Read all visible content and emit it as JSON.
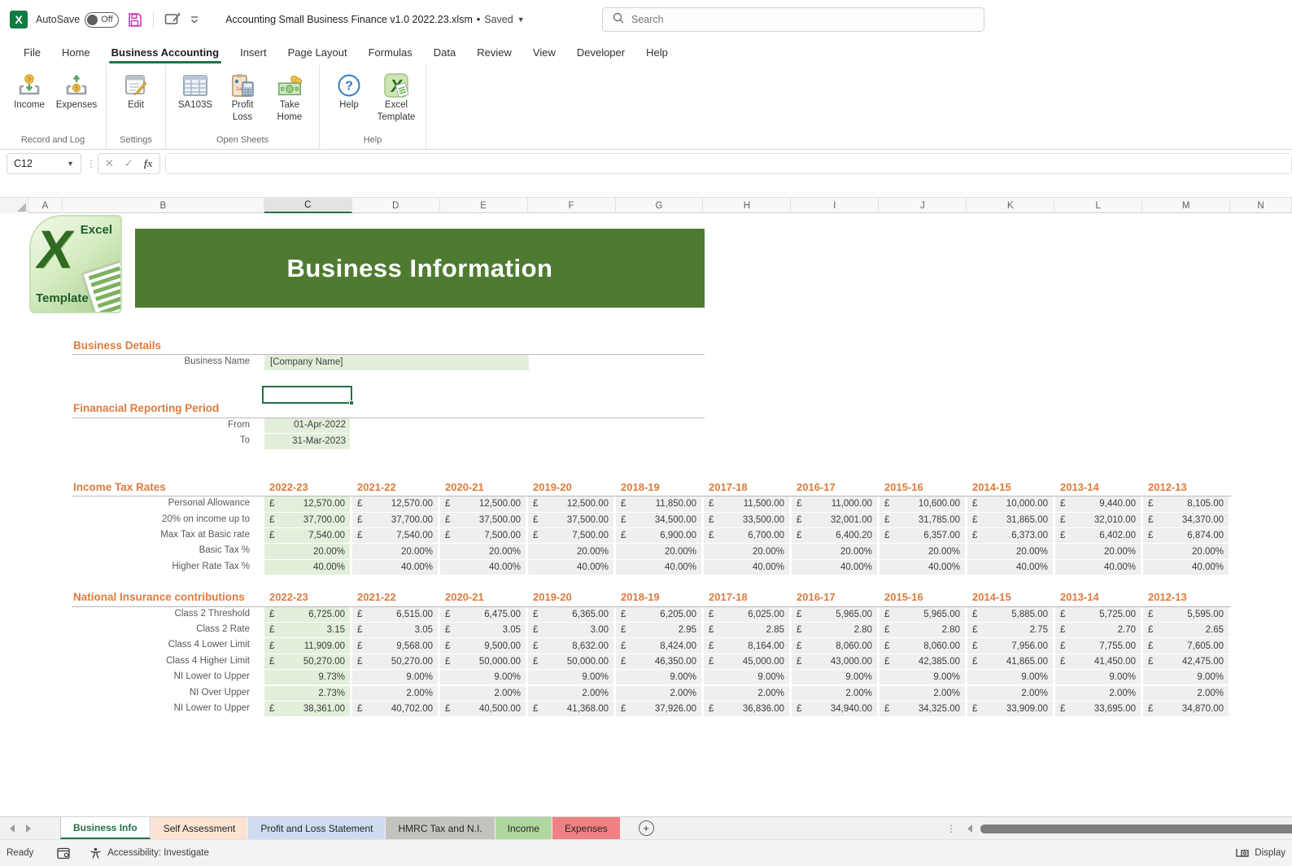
{
  "titlebar": {
    "autosave_label": "AutoSave",
    "autosave_state": "Off",
    "filename": "Accounting Small Business Finance v1.0 2022.23.xlsm",
    "separator": "•",
    "saved_status": "Saved",
    "search_placeholder": "Search"
  },
  "menu": {
    "tabs": [
      "File",
      "Home",
      "Business Accounting",
      "Insert",
      "Page Layout",
      "Formulas",
      "Data",
      "Review",
      "View",
      "Developer",
      "Help"
    ],
    "active": "Business Accounting"
  },
  "ribbon": {
    "groups": [
      {
        "label": "Record and Log",
        "buttons": [
          {
            "label": "Income",
            "icon": "income-tray-icon"
          },
          {
            "label": "Expenses",
            "icon": "expenses-tray-icon"
          }
        ]
      },
      {
        "label": "Settings",
        "buttons": [
          {
            "label": "Edit",
            "icon": "edit-pad-icon"
          }
        ]
      },
      {
        "label": "Open Sheets",
        "buttons": [
          {
            "label": "SA103S",
            "icon": "sheet-grid-icon"
          },
          {
            "label": "Profit Loss",
            "icon": "clipboard-calculator-icon"
          },
          {
            "label": "Take Home",
            "icon": "money-icon"
          }
        ]
      },
      {
        "label": "Help",
        "buttons": [
          {
            "label": "Help",
            "icon": "help-circle-icon"
          },
          {
            "label": "Excel Template",
            "icon": "excel-template-icon"
          }
        ]
      }
    ]
  },
  "formulabar": {
    "name_box": "C12",
    "fx_label": "fx",
    "formula_value": ""
  },
  "grid": {
    "columns": [
      "A",
      "B",
      "C",
      "D",
      "E",
      "F",
      "G",
      "H",
      "I",
      "J",
      "K",
      "L",
      "M",
      "N"
    ],
    "selected_column": "C",
    "row_from": 1,
    "row_to": 38,
    "selected_row": 12,
    "selected_cell": "C12"
  },
  "sheet": {
    "logo": {
      "line1": "Excel",
      "big_letter": "X",
      "line2": "Template"
    },
    "banner_title": "Business Information",
    "business_details": {
      "heading": "Business Details",
      "fields": [
        {
          "label": "Business Name",
          "value": "[Company Name]"
        }
      ]
    },
    "reporting_period": {
      "heading": "Finanacial Reporting Period",
      "fields": [
        {
          "label": "From",
          "value": "01-Apr-2022"
        },
        {
          "label": "To",
          "value": "31-Mar-2023"
        }
      ]
    },
    "years": [
      "2022-23",
      "2021-22",
      "2020-21",
      "2019-20",
      "2018-19",
      "2017-18",
      "2016-17",
      "2015-16",
      "2014-15",
      "2013-14",
      "2012-13"
    ],
    "tables": [
      {
        "title": "Income Tax Rates",
        "header_row": 18,
        "first_data_row": 19,
        "rows": [
          {
            "label": "Personal Allowance",
            "currency": true,
            "values": [
              "12,570.00",
              "12,570.00",
              "12,500.00",
              "12,500.00",
              "11,850.00",
              "11,500.00",
              "11,000.00",
              "10,600.00",
              "10,000.00",
              "9,440.00",
              "8,105.00"
            ]
          },
          {
            "label": "20% on income up to",
            "currency": true,
            "values": [
              "37,700.00",
              "37,700.00",
              "37,500.00",
              "37,500.00",
              "34,500.00",
              "33,500.00",
              "32,001.00",
              "31,785.00",
              "31,865.00",
              "32,010.00",
              "34,370.00"
            ]
          },
          {
            "label": "Max Tax at Basic rate",
            "currency": true,
            "values": [
              "7,540.00",
              "7,540.00",
              "7,500.00",
              "7,500.00",
              "6,900.00",
              "6,700.00",
              "6,400.20",
              "6,357.00",
              "6,373.00",
              "6,402.00",
              "6,874.00"
            ]
          },
          {
            "label": "Basic Tax %",
            "currency": false,
            "values": [
              "20.00%",
              "20.00%",
              "20.00%",
              "20.00%",
              "20.00%",
              "20.00%",
              "20.00%",
              "20.00%",
              "20.00%",
              "20.00%",
              "20.00%"
            ]
          },
          {
            "label": "Higher Rate Tax %",
            "currency": false,
            "values": [
              "40.00%",
              "40.00%",
              "40.00%",
              "40.00%",
              "40.00%",
              "40.00%",
              "40.00%",
              "40.00%",
              "40.00%",
              "40.00%",
              "40.00%"
            ]
          }
        ]
      },
      {
        "title": "National Insurance contributions",
        "header_row": 25,
        "first_data_row": 26,
        "rows": [
          {
            "label": "Class 2 Threshold",
            "currency": true,
            "values": [
              "6,725.00",
              "6,515.00",
              "6,475.00",
              "6,365.00",
              "6,205.00",
              "6,025.00",
              "5,965.00",
              "5,965.00",
              "5,885.00",
              "5,725.00",
              "5,595.00"
            ]
          },
          {
            "label": "Class 2 Rate",
            "currency": true,
            "values": [
              "3.15",
              "3.05",
              "3.05",
              "3.00",
              "2.95",
              "2.85",
              "2.80",
              "2.80",
              "2.75",
              "2.70",
              "2.65"
            ]
          },
          {
            "label": "Class 4 Lower Limit",
            "currency": true,
            "values": [
              "11,909.00",
              "9,568.00",
              "9,500.00",
              "8,632.00",
              "8,424.00",
              "8,164.00",
              "8,060.00",
              "8,060.00",
              "7,956.00",
              "7,755.00",
              "7,605.00"
            ]
          },
          {
            "label": "Class 4 Higher Limit",
            "currency": true,
            "values": [
              "50,270.00",
              "50,270.00",
              "50,000.00",
              "50,000.00",
              "46,350.00",
              "45,000.00",
              "43,000.00",
              "42,385.00",
              "41,865.00",
              "41,450.00",
              "42,475.00"
            ]
          },
          {
            "label": "NI Lower to Upper",
            "currency": false,
            "values": [
              "9.73%",
              "9.00%",
              "9.00%",
              "9.00%",
              "9.00%",
              "9.00%",
              "9.00%",
              "9.00%",
              "9.00%",
              "9.00%",
              "9.00%"
            ]
          },
          {
            "label": "NI Over Upper",
            "currency": false,
            "values": [
              "2.73%",
              "2.00%",
              "2.00%",
              "2.00%",
              "2.00%",
              "2.00%",
              "2.00%",
              "2.00%",
              "2.00%",
              "2.00%",
              "2.00%"
            ]
          },
          {
            "label": "NI Lower to Upper",
            "currency": true,
            "values": [
              "38,361.00",
              "40,702.00",
              "40,500.00",
              "41,368.00",
              "37,926.00",
              "36,836.00",
              "34,940.00",
              "34,325.00",
              "33,909.00",
              "33,695.00",
              "34,870.00"
            ]
          }
        ]
      }
    ],
    "currency_symbol": "£"
  },
  "tabbar": {
    "sheets": [
      {
        "label": "Business Info",
        "color": "#ffffff",
        "active": true
      },
      {
        "label": "Self Assessment",
        "color": "#fbe3d3",
        "active": false
      },
      {
        "label": "Profit and Loss Statement",
        "color": "#cfdcf0",
        "active": false
      },
      {
        "label": "HMRC Tax and N.I.",
        "color": "#c3c3c0",
        "active": false
      },
      {
        "label": "Income",
        "color": "#b0d89e",
        "active": false
      },
      {
        "label": "Expenses",
        "color": "#f08083",
        "active": false
      }
    ],
    "add_label": "+"
  },
  "statusbar": {
    "ready": "Ready",
    "accessibility": "Accessibility: Investigate",
    "display": "Display"
  },
  "colors": {
    "accent_green": "#217346",
    "banner_green": "#4f7b31",
    "heading_orange": "#dd7b3d",
    "cell_green": "#e2efda",
    "cell_gray": "#eff0ee"
  }
}
